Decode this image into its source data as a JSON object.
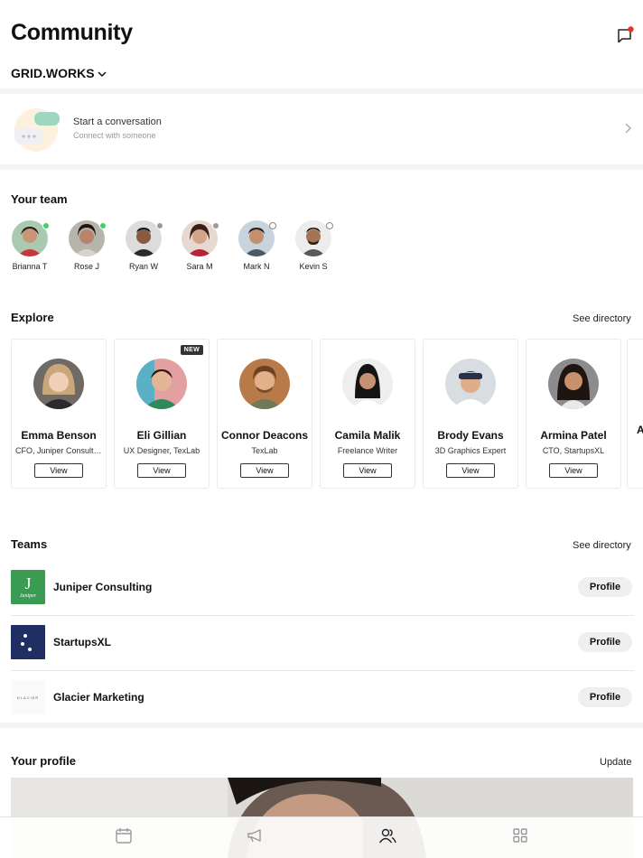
{
  "header": {
    "title": "Community",
    "org_name": "GRID.WORKS",
    "notification_color": "#e5352b"
  },
  "conversation": {
    "title": "Start a conversation",
    "subtitle": "Connect with someone"
  },
  "team": {
    "title": "Your team",
    "members": [
      {
        "name": "Brianna T",
        "status": "online"
      },
      {
        "name": "Rose J",
        "status": "online"
      },
      {
        "name": "Ryan W",
        "status": "away"
      },
      {
        "name": "Sara M",
        "status": "away"
      },
      {
        "name": "Mark N",
        "status": "offline"
      },
      {
        "name": "Kevin S",
        "status": "offline"
      }
    ]
  },
  "explore": {
    "title": "Explore",
    "link": "See directory",
    "view_label": "View",
    "new_badge": "NEW",
    "people": [
      {
        "name": "Emma Benson",
        "role": "CFO, Juniper Consulting"
      },
      {
        "name": "Eli Gillian",
        "role": "UX Designer, TexLab"
      },
      {
        "name": "Connor Deacons",
        "role": "TexLab"
      },
      {
        "name": "Camila Malik",
        "role": "Freelance Writer"
      },
      {
        "name": "Brody Evans",
        "role": "3D Graphics Expert"
      },
      {
        "name": "Armina Patel",
        "role": "CTO, StartupsXL"
      }
    ],
    "partial_initial": "A"
  },
  "teams": {
    "title": "Teams",
    "link": "See directory",
    "profile_label": "Profile",
    "items": [
      {
        "name": "Juniper Consulting",
        "logo_letter": "J",
        "logo_sub": "Juniper"
      },
      {
        "name": "StartupsXL"
      },
      {
        "name": "Glacier Marketing",
        "logo_text": "GLACIER"
      }
    ]
  },
  "profile": {
    "title": "Your profile",
    "link": "Update"
  },
  "colors": {
    "online": "#3ecf6e",
    "away": "#9a9a9a",
    "juniper": "#3a9b52",
    "startups": "#1f2e63"
  }
}
